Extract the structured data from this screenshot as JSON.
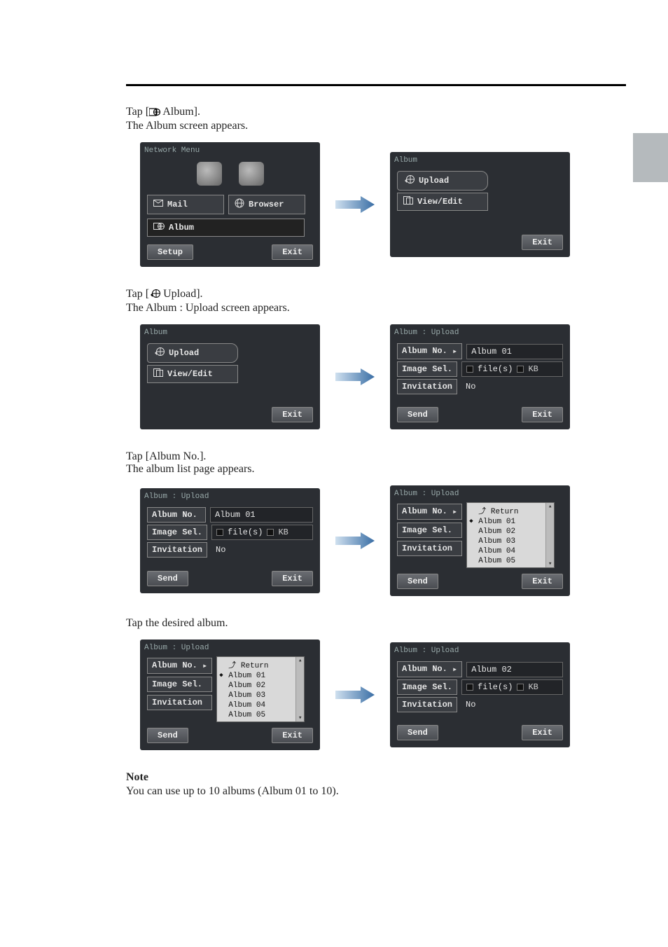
{
  "step1": {
    "label": "Tap [ Album].",
    "desc": "The Album screen appears."
  },
  "step2": {
    "label": "Tap [ Upload].",
    "desc": "The Album : Upload screen appears."
  },
  "step3": {
    "label": "Tap [Album No.].",
    "desc": "The album list page appears."
  },
  "step4": {
    "label": "Tap the desired album."
  },
  "note": {
    "label": "Note",
    "text": "You can use up to 10 albums (Album 01 to 10)."
  },
  "ui": {
    "network_menu": "Network Menu",
    "mail": "Mail",
    "browser": "Browser",
    "album_menu": "Album",
    "setup": "Setup",
    "exit": "Exit",
    "album_title": "Album",
    "upload": "Upload",
    "viewedit": "View/Edit",
    "album_upload_title": "Album : Upload",
    "album_no": "Album No.",
    "image_sel": "Image Sel.",
    "invitation": "Invitation",
    "files": "file(s)",
    "kb": "KB",
    "no": "No",
    "send": "Send",
    "album01": "Album 01",
    "album02": "Album 02",
    "return": "Return"
  },
  "album_list": {
    "return": "Return",
    "items": [
      "Album 01",
      "Album 02",
      "Album 03",
      "Album 04",
      "Album 05"
    ]
  }
}
